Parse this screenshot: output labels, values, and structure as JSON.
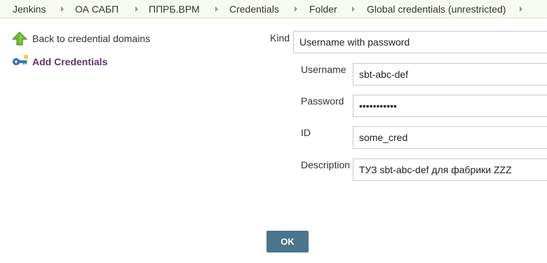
{
  "breadcrumbs": [
    "Jenkins",
    "ОА САБП",
    "ППРБ.ВРМ",
    "Credentials",
    "Folder",
    "Global credentials (unrestricted)"
  ],
  "sidebar": {
    "back_link": "Back to credential domains",
    "add_credentials": "Add Credentials"
  },
  "form": {
    "kind_label": "Kind",
    "kind_value": "Username with password",
    "username_label": "Username",
    "username_value": "sbt-abc-def",
    "password_label": "Password",
    "password_value": "•••••••••••",
    "id_label": "ID",
    "id_value": "some_cred",
    "description_label": "Description",
    "description_value": "ТУЗ sbt-abc-def для фабрики ZZZ"
  },
  "ok_label": "OK",
  "colors": {
    "ok_button": "#4b758b",
    "link_purple": "#5c3566",
    "breadcrumb_bg": "#f6faf2"
  },
  "icons": {
    "back": "green-up-arrow-icon",
    "add": "key-icon"
  }
}
